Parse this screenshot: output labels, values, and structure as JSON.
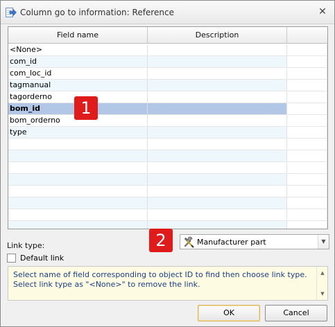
{
  "window": {
    "title": "Column go to information: Reference",
    "close_label": "✕"
  },
  "grid": {
    "columns": [
      "Field name",
      "Description",
      ""
    ],
    "rows": [
      {
        "field": "<None>",
        "description": ""
      },
      {
        "field": "com_id",
        "description": ""
      },
      {
        "field": "com_loc_id",
        "description": ""
      },
      {
        "field": "tagmanual",
        "description": ""
      },
      {
        "field": "tagorderno",
        "description": ""
      },
      {
        "field": "bom_id",
        "description": "",
        "selected": true
      },
      {
        "field": "bom_orderno",
        "description": ""
      },
      {
        "field": "type",
        "description": ""
      },
      {
        "field": "",
        "description": ""
      },
      {
        "field": "",
        "description": ""
      },
      {
        "field": "",
        "description": ""
      },
      {
        "field": "",
        "description": ""
      },
      {
        "field": "",
        "description": ""
      },
      {
        "field": "",
        "description": ""
      },
      {
        "field": "",
        "description": ""
      },
      {
        "field": "",
        "description": ""
      }
    ]
  },
  "badges": {
    "one": "1",
    "two": "2"
  },
  "link_type": {
    "label": "Link type:",
    "value": "Manufacturer part",
    "icon": "tools-icon"
  },
  "default_link": {
    "label": "Default link",
    "checked": false
  },
  "hint": {
    "text": "Select name of field corresponding to object ID to find then choose link type. Select link type as \"<None>\" to remove the link."
  },
  "buttons": {
    "ok": "OK",
    "cancel": "Cancel"
  },
  "colors": {
    "selected_row": "#b2c6e6",
    "alt_row": "#eef7fb",
    "badge": "#e01b1b",
    "hint_background": "#fdfbe1",
    "hint_text": "#1a3f85"
  }
}
